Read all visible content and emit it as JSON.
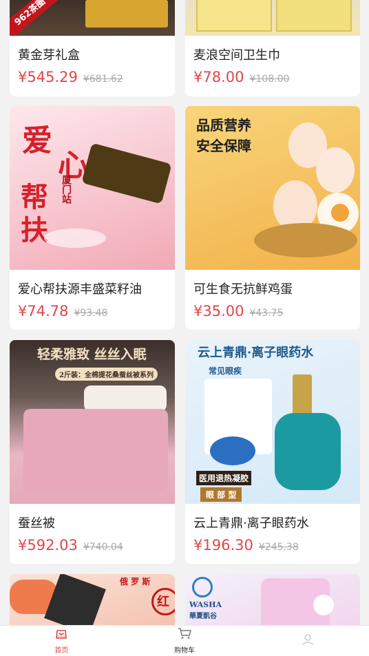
{
  "products": [
    {
      "title": "黄金芽礼盒",
      "price": "¥545.29",
      "old_price": "¥681.62",
      "badge": "962茶圈",
      "image_icon": "gift-box-image"
    },
    {
      "title": "麦浪空间卫生巾",
      "price": "¥78.00",
      "old_price": "¥108.00",
      "image_icon": "tissue-box-image"
    },
    {
      "title": "爱心帮扶源丰盛菜籽油",
      "price": "¥74.78",
      "old_price": "¥93.48",
      "image_text": [
        "爱",
        "心",
        "帮",
        "扶",
        "厦门站"
      ],
      "image_icon": "oil-bottle-image"
    },
    {
      "title": "可生食无抗鲜鸡蛋",
      "price": "¥35.00",
      "old_price": "¥43.75",
      "image_text": [
        "品质营养",
        "安全保障"
      ],
      "image_icon": "eggs-image"
    },
    {
      "title": "蚕丝被",
      "price": "¥592.03",
      "old_price": "¥740.04",
      "image_text": [
        "轻柔雅致  丝丝入眠",
        "2斤装：全棉提花桑蚕丝被系列"
      ],
      "image_icon": "quilt-image"
    },
    {
      "title": "云上青鼎·离子眼药水",
      "price": "¥196.30",
      "old_price": "¥245.38",
      "image_text": [
        "云上青鼎·离子眼药水",
        "常见眼疾",
        "医用退热凝胶",
        "眼 部 型"
      ],
      "image_icon": "eye-drops-image"
    },
    {
      "title": "",
      "price": "",
      "old_price": "",
      "image_text": [
        "俄 罗 斯",
        "红"
      ],
      "image_icon": "sushi-image"
    },
    {
      "title": "",
      "price": "",
      "old_price": "",
      "image_text": [
        "WASHA",
        "華夏凱谷"
      ],
      "image_icon": "detergent-image"
    }
  ],
  "tabbar": {
    "home": "首页",
    "cart": "购物车"
  },
  "colors": {
    "accent": "#e0454a",
    "background": "#f2f2f2"
  }
}
